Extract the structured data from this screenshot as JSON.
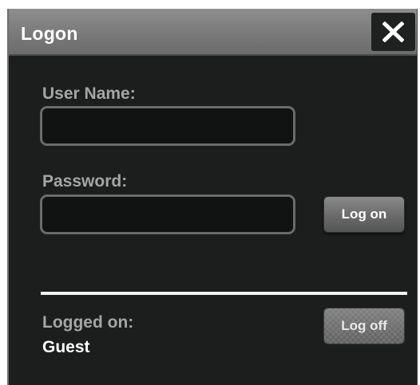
{
  "dialog": {
    "title": "Logon",
    "close_icon": "close-x-icon"
  },
  "form": {
    "username_label": "User Name:",
    "username_value": "",
    "password_label": "Password:",
    "password_value": "",
    "logon_button_label": "Log on"
  },
  "status": {
    "logged_on_label": "Logged on:",
    "current_user": "Guest",
    "logoff_button_label": "Log off"
  }
}
